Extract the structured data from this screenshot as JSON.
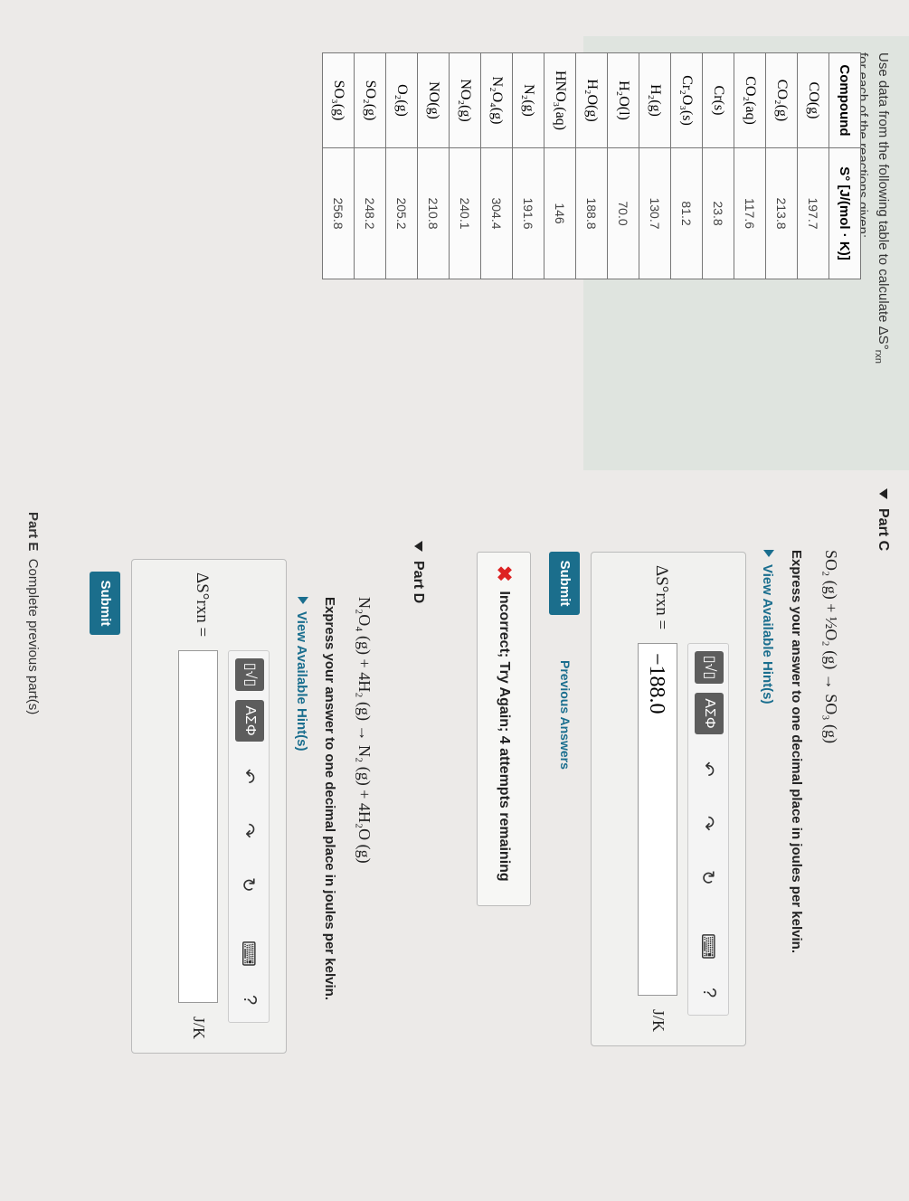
{
  "intro": {
    "line1": "Use data from the following table to calculate ΔS°",
    "sub": "rxn",
    "line2": "for each of the reactions given:"
  },
  "table": {
    "headers": [
      "Compound",
      "S° [J/(mol · K)]"
    ],
    "rows": [
      {
        "compound": "CO(g)",
        "value": "197.7"
      },
      {
        "compound": "CO₂(g)",
        "value": "213.8"
      },
      {
        "compound": "CO₂(aq)",
        "value": "117.6"
      },
      {
        "compound": "Cr(s)",
        "value": "23.8"
      },
      {
        "compound": "Cr₂O₃(s)",
        "value": "81.2"
      },
      {
        "compound": "H₂(g)",
        "value": "130.7"
      },
      {
        "compound": "H₂O(l)",
        "value": "70.0"
      },
      {
        "compound": "H₂O(g)",
        "value": "188.8"
      },
      {
        "compound": "HNO₃(aq)",
        "value": "146"
      },
      {
        "compound": "N₂(g)",
        "value": "191.6"
      },
      {
        "compound": "N₂O₄(g)",
        "value": "304.4"
      },
      {
        "compound": "NO₂(g)",
        "value": "240.1"
      },
      {
        "compound": "NO(g)",
        "value": "210.8"
      },
      {
        "compound": "O₂(g)",
        "value": "205.2"
      },
      {
        "compound": "SO₂(g)",
        "value": "248.2"
      },
      {
        "compound": "SO₃(g)",
        "value": "256.8"
      }
    ]
  },
  "partC": {
    "title": "Part C",
    "equation": "SO₂ (g) + ½O₂ (g) → SO₃ (g)",
    "instruction": "Express your answer to one decimal place in joules per kelvin.",
    "hint": "View Available Hint(s)",
    "label": "ΔS°rxn =",
    "answer": "−188.0",
    "unit": "J/K",
    "submit": "Submit",
    "previous": "Previous Answers",
    "feedback": "Incorrect; Try Again; 4 attempts remaining"
  },
  "partD": {
    "title": "Part D",
    "equation": "N₂O₄ (g) + 4H₂ (g) → N₂ (g) + 4H₂O (g)",
    "instruction": "Express your answer to one decimal place in joules per kelvin.",
    "hint": "View Available Hint(s)",
    "label": "ΔS°rxn =",
    "answer": "",
    "unit": "J/K",
    "submit": "Submit"
  },
  "toolbar": {
    "templates": "▯√▯",
    "symbols": "ΑΣΦ",
    "undo": "↶",
    "redo": "↷",
    "reset": "↻",
    "keyboard": "⌨",
    "help": "?"
  },
  "partE": {
    "title": "Part E",
    "text": "Complete previous part(s)"
  }
}
